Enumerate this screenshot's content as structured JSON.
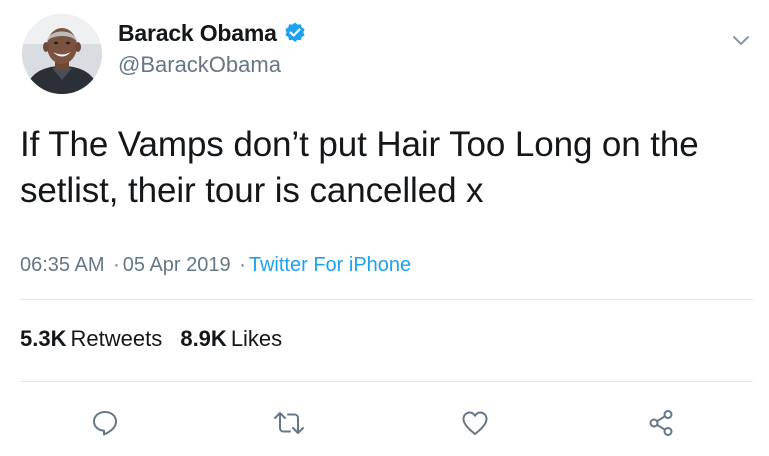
{
  "author": {
    "display_name": "Barack Obama",
    "handle": "@BarackObama",
    "verified": true,
    "avatar_icon": "profile-photo"
  },
  "tweet": {
    "text": "If The Vamps don’t put Hair Too Long on the setlist, their tour is cancelled x",
    "time": "06:35 AM",
    "date": "05 Apr 2019",
    "source": "Twitter For iPhone",
    "separator": "·"
  },
  "stats": {
    "retweets_count": "5.3K",
    "retweets_label": "Retweets",
    "likes_count": "8.9K",
    "likes_label": "Likes"
  },
  "actions": {
    "reply_icon": "speech-bubble-icon",
    "retweet_icon": "retweet-arrows-icon",
    "like_icon": "heart-icon",
    "share_icon": "share-nodes-icon"
  },
  "colors": {
    "text": "#14171a",
    "muted": "#657786",
    "accent": "#1da1f2",
    "divider": "#e1e8ed"
  }
}
